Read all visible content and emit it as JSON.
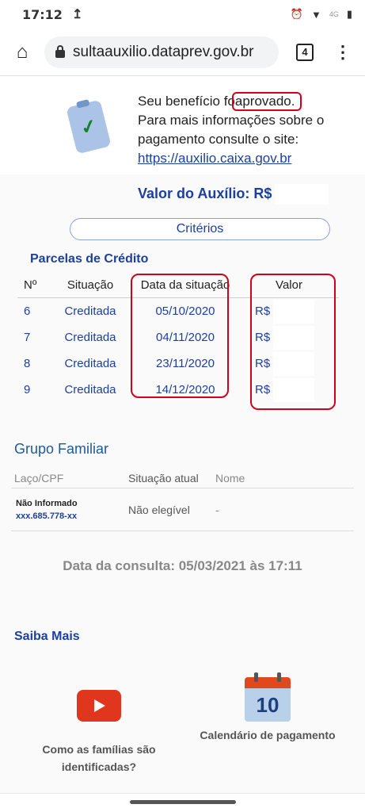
{
  "status": {
    "time": "17:12",
    "upload_glyph": "↥",
    "alarm_glyph": "⏰",
    "wifi_glyph": "▼",
    "network": "4G",
    "battery_glyph": "▮"
  },
  "browser": {
    "url": "sultaauxilio.dataprev.gov.br",
    "tab_count": "4",
    "home_glyph": "⌂",
    "menu_glyph": "⋮"
  },
  "approved": {
    "line1_before": "Seu benefício fo",
    "line1_highlight": "aprovado.",
    "line2": "Para mais informações sobre o pagamento consulte o site:",
    "link": "https://auxilio.caixa.gov.br",
    "check_glyph": "✓"
  },
  "valor": {
    "label": "Valor do Auxílio: R$"
  },
  "criterios_label": "Critérios",
  "parcelas": {
    "title": "Parcelas de Crédito",
    "headers": [
      "Nº",
      "Situação",
      "Data da situação",
      "Valor"
    ],
    "rows": [
      {
        "n": "6",
        "situacao": "Creditada",
        "data": "05/10/2020",
        "valor": "R$"
      },
      {
        "n": "7",
        "situacao": "Creditada",
        "data": "04/11/2020",
        "valor": "R$"
      },
      {
        "n": "8",
        "situacao": "Creditada",
        "data": "23/11/2020",
        "valor": "R$"
      },
      {
        "n": "9",
        "situacao": "Creditada",
        "data": "14/12/2020",
        "valor": "R$"
      }
    ]
  },
  "grupo": {
    "title": "Grupo Familiar",
    "headers": [
      "Laço/CPF",
      "Situação atual",
      "Nome"
    ],
    "row": {
      "laco": "Não Informado",
      "cpf": "xxx.685.778-xx",
      "situacao": "Não elegível",
      "nome": "-"
    }
  },
  "consulta": "Data da consulta: 05/03/2021 às 17:11",
  "saiba": {
    "title": "Saiba Mais",
    "card1_label": "Como as famílias são identificadas?",
    "card2_label": "Calendário de pagamento",
    "calendar_day": "10"
  },
  "colors": {
    "blue": "#1d3f9f",
    "red_annotation": "#d0021b",
    "youtube": "#e0361d"
  }
}
